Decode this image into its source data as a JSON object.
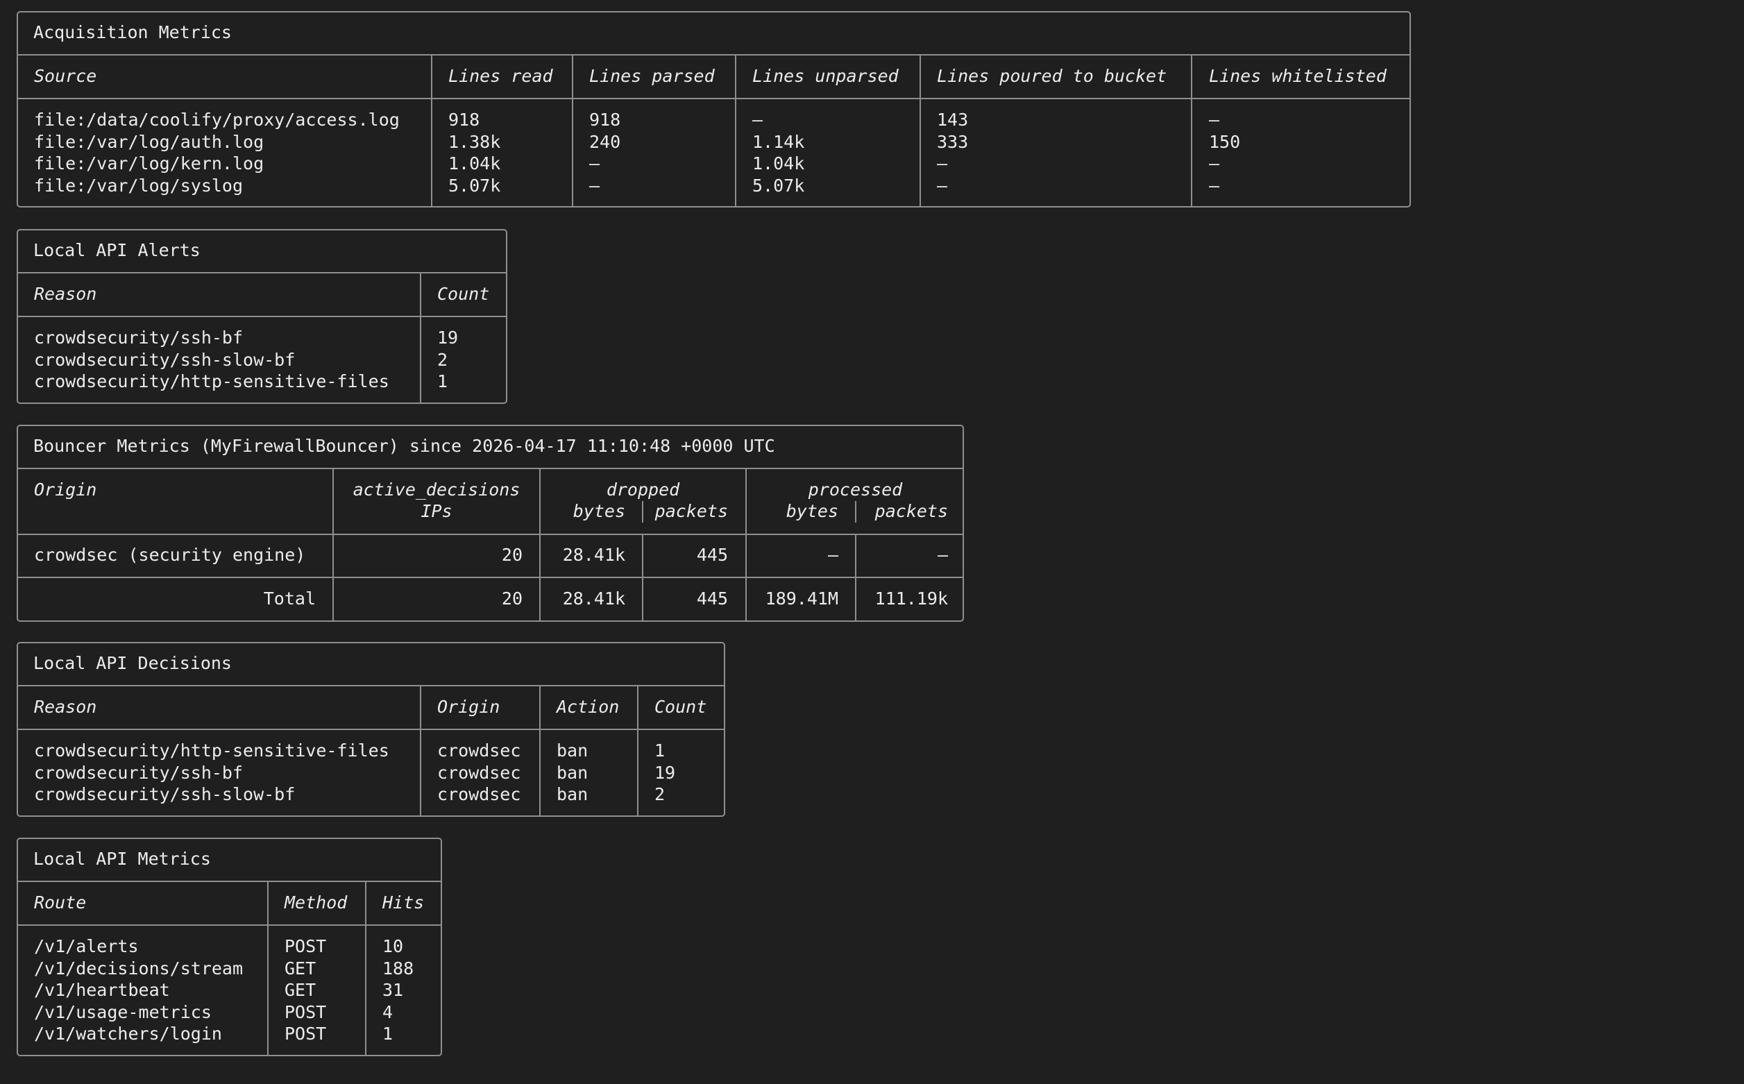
{
  "acquisition": {
    "title": "Acquisition Metrics",
    "headers": [
      "Source",
      "Lines read",
      "Lines parsed",
      "Lines unparsed",
      "Lines poured to bucket",
      "Lines whitelisted"
    ],
    "rows": [
      [
        "file:/data/coolify/proxy/access.log",
        "918",
        "918",
        "–",
        "143",
        "–"
      ],
      [
        "file:/var/log/auth.log",
        "1.38k",
        "240",
        "1.14k",
        "333",
        "150"
      ],
      [
        "file:/var/log/kern.log",
        "1.04k",
        "–",
        "1.04k",
        "–",
        "–"
      ],
      [
        "file:/var/log/syslog",
        "5.07k",
        "–",
        "5.07k",
        "–",
        "–"
      ]
    ]
  },
  "alerts": {
    "title": "Local API Alerts",
    "headers": [
      "Reason",
      "Count"
    ],
    "rows": [
      [
        "crowdsecurity/ssh-bf",
        "19"
      ],
      [
        "crowdsecurity/ssh-slow-bf",
        "2"
      ],
      [
        "crowdsecurity/http-sensitive-files",
        "1"
      ]
    ]
  },
  "bouncer": {
    "title": "Bouncer Metrics (MyFirewallBouncer) since 2026-04-17 11:10:48 +0000 UTC",
    "headers": {
      "origin": "Origin",
      "active_decisions": "active_decisions",
      "ips": "IPs",
      "dropped": "dropped",
      "processed": "processed",
      "bytes": "bytes",
      "packets": "packets"
    },
    "row": {
      "origin": "crowdsec (security engine)",
      "ips": "20",
      "dropped_bytes": "28.41k",
      "dropped_packets": "445",
      "processed_bytes": "–",
      "processed_packets": "–"
    },
    "total": {
      "label": "Total",
      "ips": "20",
      "dropped_bytes": "28.41k",
      "dropped_packets": "445",
      "processed_bytes": "189.41M",
      "processed_packets": "111.19k"
    }
  },
  "decisions": {
    "title": "Local API Decisions",
    "headers": [
      "Reason",
      "Origin",
      "Action",
      "Count"
    ],
    "rows": [
      [
        "crowdsecurity/http-sensitive-files",
        "crowdsec",
        "ban",
        "1"
      ],
      [
        "crowdsecurity/ssh-bf",
        "crowdsec",
        "ban",
        "19"
      ],
      [
        "crowdsecurity/ssh-slow-bf",
        "crowdsec",
        "ban",
        "2"
      ]
    ]
  },
  "lapi": {
    "title": "Local API Metrics",
    "headers": [
      "Route",
      "Method",
      "Hits"
    ],
    "rows": [
      [
        "/v1/alerts",
        "POST",
        "10"
      ],
      [
        "/v1/decisions/stream",
        "GET",
        "188"
      ],
      [
        "/v1/heartbeat",
        "GET",
        "31"
      ],
      [
        "/v1/usage-metrics",
        "POST",
        "4"
      ],
      [
        "/v1/watchers/login",
        "POST",
        "1"
      ]
    ]
  }
}
